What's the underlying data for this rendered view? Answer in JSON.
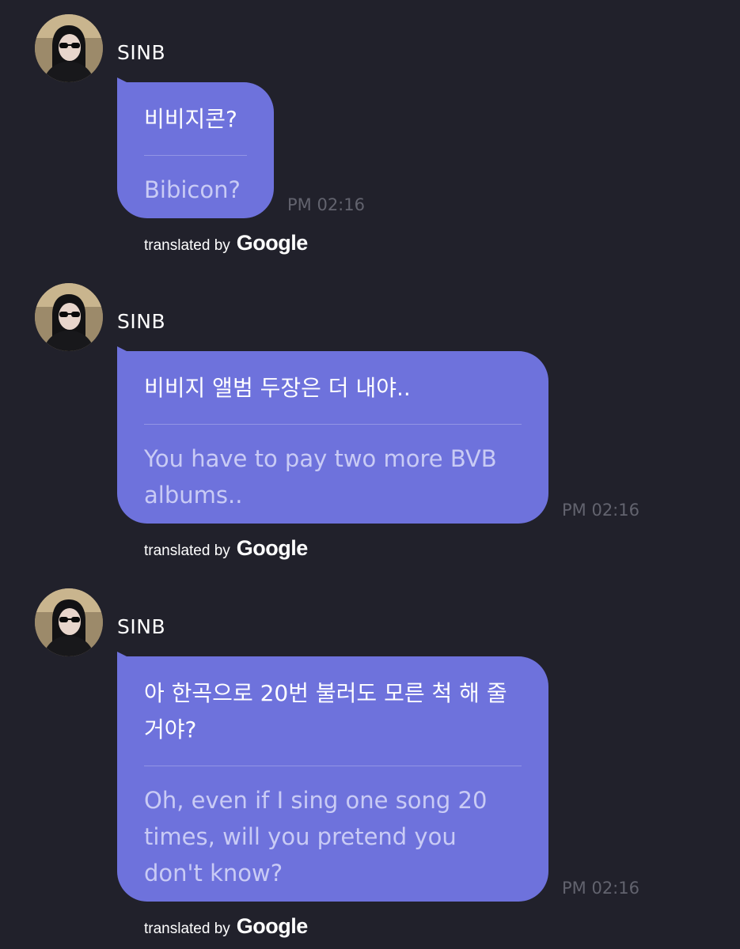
{
  "messages": [
    {
      "sender": "SINB",
      "original": "비비지콘?",
      "translation": "Bibicon?",
      "time": "PM 02:16",
      "credit_text": "translated by",
      "credit_brand": "Google"
    },
    {
      "sender": "SINB",
      "original": "비비지 앨범 두장은 더 내야..",
      "translation": "You have to pay two more BVB albums..",
      "time": "PM 02:16",
      "credit_text": "translated by",
      "credit_brand": "Google"
    },
    {
      "sender": "SINB",
      "original": "아 한곡으로 20번 불러도 모른 척 해 줄거야?",
      "translation": "Oh, even if I sing one song 20 times, will you pretend you don't know?",
      "time": "PM 02:16",
      "credit_text": "translated by",
      "credit_brand": "Google"
    }
  ],
  "colors": {
    "background": "#21212b",
    "bubble": "#6e72dc",
    "translation_text": "#c9cbf5",
    "timestamp": "#62636e"
  }
}
